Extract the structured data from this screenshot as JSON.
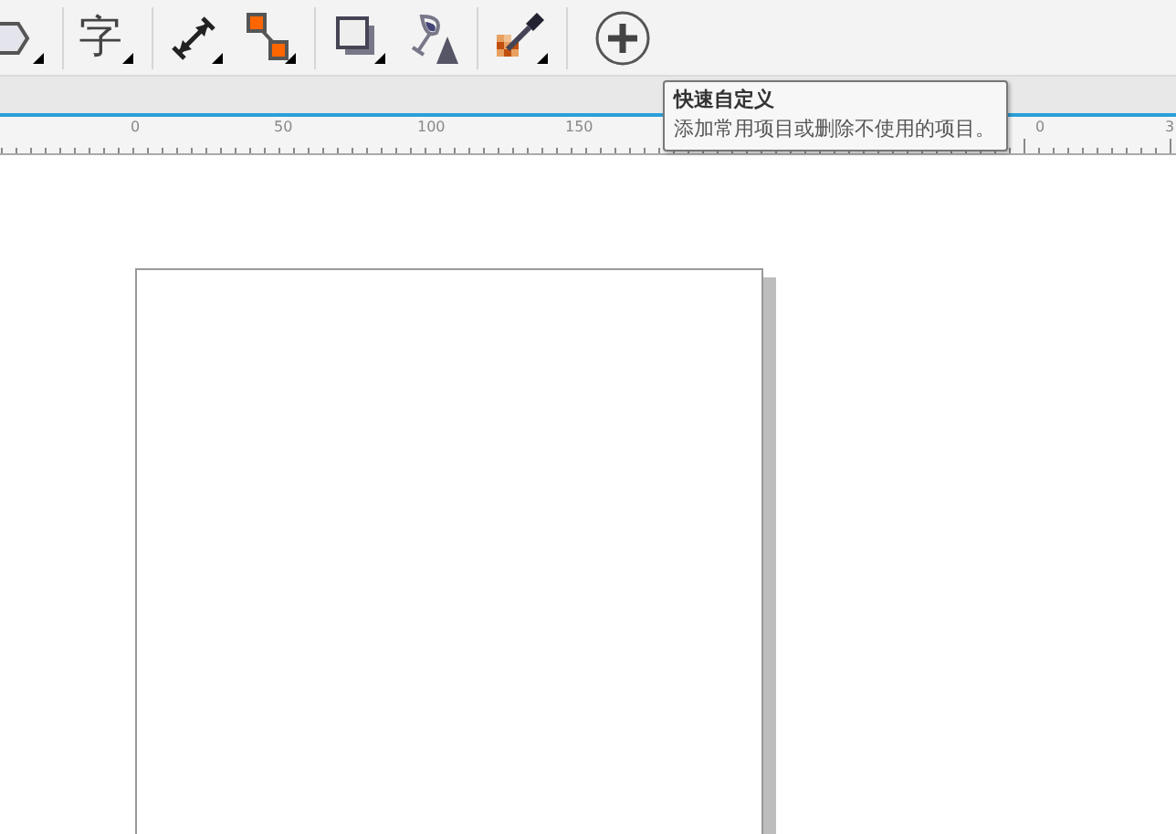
{
  "toolbar": {
    "groups": [
      [
        {
          "kind": "polygon"
        }
      ],
      [
        {
          "kind": "text",
          "glyph": "字"
        }
      ],
      [
        {
          "kind": "dimension"
        },
        {
          "kind": "connector"
        }
      ],
      [
        {
          "kind": "shadow"
        },
        {
          "kind": "transparency"
        }
      ],
      [
        {
          "kind": "eyedropper"
        }
      ],
      [
        {
          "kind": "add"
        }
      ]
    ]
  },
  "tooltip": {
    "title": "快速自定义",
    "description": "添加常用项目或删除不使用的项目。"
  },
  "ruler": {
    "labels": [
      "0",
      "50",
      "100",
      "150",
      "0",
      "3"
    ]
  }
}
